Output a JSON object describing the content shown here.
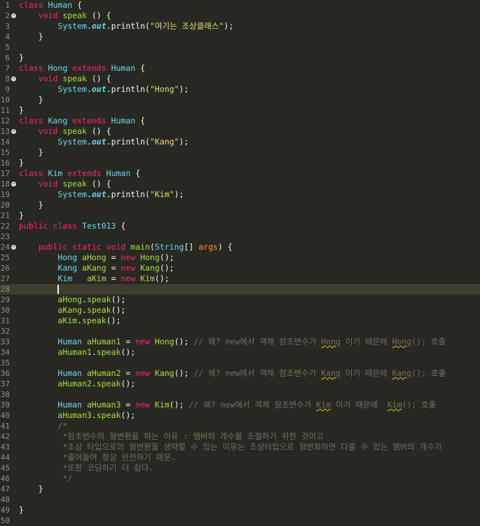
{
  "editor": {
    "current_line": 28,
    "lines": [
      {
        "n": 1,
        "fold": false,
        "segs": [
          [
            "k",
            "class "
          ],
          [
            "t",
            "Human"
          ],
          [
            "o",
            " {"
          ]
        ]
      },
      {
        "n": 2,
        "fold": true,
        "segs": [
          [
            "o",
            "    "
          ],
          [
            "k",
            "void "
          ],
          [
            "f",
            "speak"
          ],
          [
            "o",
            " () {"
          ]
        ]
      },
      {
        "n": 3,
        "fold": false,
        "segs": [
          [
            "o",
            "        "
          ],
          [
            "t",
            "System"
          ],
          [
            "o",
            "."
          ],
          [
            "fi",
            "out"
          ],
          [
            "o",
            "."
          ],
          [
            "o",
            "println("
          ],
          [
            "s",
            "\"여기는 조상클래스\""
          ],
          [
            "o",
            ");"
          ]
        ]
      },
      {
        "n": 4,
        "fold": false,
        "segs": [
          [
            "o",
            "    }"
          ]
        ]
      },
      {
        "n": 5,
        "fold": false,
        "segs": []
      },
      {
        "n": 6,
        "fold": false,
        "segs": [
          [
            "o",
            "}"
          ]
        ]
      },
      {
        "n": 7,
        "fold": false,
        "segs": [
          [
            "k",
            "class "
          ],
          [
            "t",
            "Hong "
          ],
          [
            "k",
            "extends "
          ],
          [
            "t",
            "Human"
          ],
          [
            "o",
            " {"
          ]
        ]
      },
      {
        "n": 8,
        "fold": true,
        "segs": [
          [
            "o",
            "    "
          ],
          [
            "k",
            "void "
          ],
          [
            "f",
            "speak"
          ],
          [
            "o",
            " () {"
          ]
        ]
      },
      {
        "n": 9,
        "fold": false,
        "segs": [
          [
            "o",
            "        "
          ],
          [
            "t",
            "System"
          ],
          [
            "o",
            "."
          ],
          [
            "fi",
            "out"
          ],
          [
            "o",
            "."
          ],
          [
            "o",
            "println("
          ],
          [
            "s",
            "\"Hong\""
          ],
          [
            "o",
            ");"
          ]
        ]
      },
      {
        "n": 10,
        "fold": false,
        "segs": [
          [
            "o",
            "    }"
          ]
        ]
      },
      {
        "n": 11,
        "fold": false,
        "segs": [
          [
            "o",
            "}"
          ]
        ]
      },
      {
        "n": 12,
        "fold": false,
        "segs": [
          [
            "k",
            "class "
          ],
          [
            "t",
            "Kang "
          ],
          [
            "k",
            "extends "
          ],
          [
            "t",
            "Human"
          ],
          [
            "o",
            " {"
          ]
        ]
      },
      {
        "n": 13,
        "fold": true,
        "segs": [
          [
            "o",
            "    "
          ],
          [
            "k",
            "void "
          ],
          [
            "f",
            "speak"
          ],
          [
            "o",
            " () {"
          ]
        ]
      },
      {
        "n": 14,
        "fold": false,
        "segs": [
          [
            "o",
            "        "
          ],
          [
            "t",
            "System"
          ],
          [
            "o",
            "."
          ],
          [
            "fi",
            "out"
          ],
          [
            "o",
            "."
          ],
          [
            "o",
            "println("
          ],
          [
            "s",
            "\"Kang\""
          ],
          [
            "o",
            ");"
          ]
        ]
      },
      {
        "n": 15,
        "fold": false,
        "segs": [
          [
            "o",
            "    }"
          ]
        ]
      },
      {
        "n": 16,
        "fold": false,
        "segs": [
          [
            "o",
            "}"
          ]
        ]
      },
      {
        "n": 17,
        "fold": false,
        "segs": [
          [
            "k",
            "class "
          ],
          [
            "t",
            "Kim "
          ],
          [
            "k",
            "extends "
          ],
          [
            "t",
            "Human"
          ],
          [
            "o",
            " {"
          ]
        ]
      },
      {
        "n": 18,
        "fold": true,
        "segs": [
          [
            "o",
            "    "
          ],
          [
            "k",
            "void "
          ],
          [
            "f",
            "speak"
          ],
          [
            "o",
            " () {"
          ]
        ]
      },
      {
        "n": 19,
        "fold": false,
        "segs": [
          [
            "o",
            "        "
          ],
          [
            "t",
            "System"
          ],
          [
            "o",
            "."
          ],
          [
            "fi",
            "out"
          ],
          [
            "o",
            "."
          ],
          [
            "o",
            "println("
          ],
          [
            "s",
            "\"Kim\""
          ],
          [
            "o",
            ");"
          ]
        ]
      },
      {
        "n": 20,
        "fold": false,
        "segs": [
          [
            "o",
            "    }"
          ]
        ]
      },
      {
        "n": 21,
        "fold": false,
        "segs": [
          [
            "o",
            "}"
          ]
        ]
      },
      {
        "n": 22,
        "fold": false,
        "segs": [
          [
            "k",
            "public class "
          ],
          [
            "t",
            "Test013"
          ],
          [
            "o",
            " {"
          ]
        ]
      },
      {
        "n": 23,
        "fold": false,
        "segs": []
      },
      {
        "n": 24,
        "fold": true,
        "segs": [
          [
            "o",
            "    "
          ],
          [
            "k",
            "public static void "
          ],
          [
            "f",
            "main"
          ],
          [
            "o",
            "("
          ],
          [
            "t",
            "String"
          ],
          [
            "o",
            "[] "
          ],
          [
            "p",
            "args"
          ],
          [
            "o",
            ") {"
          ]
        ]
      },
      {
        "n": 25,
        "fold": false,
        "segs": [
          [
            "o",
            "        "
          ],
          [
            "t",
            "Hong "
          ],
          [
            "f",
            "aHong"
          ],
          [
            "o",
            " = "
          ],
          [
            "k",
            "new "
          ],
          [
            "f",
            "Hong"
          ],
          [
            "o",
            "();"
          ]
        ]
      },
      {
        "n": 26,
        "fold": false,
        "segs": [
          [
            "o",
            "        "
          ],
          [
            "t",
            "Kang "
          ],
          [
            "f",
            "aKang"
          ],
          [
            "o",
            " = "
          ],
          [
            "k",
            "new "
          ],
          [
            "f",
            "Kang"
          ],
          [
            "o",
            "();"
          ]
        ]
      },
      {
        "n": 27,
        "fold": false,
        "segs": [
          [
            "o",
            "        "
          ],
          [
            "t",
            "Kim   "
          ],
          [
            "f",
            "aKim"
          ],
          [
            "o",
            " = "
          ],
          [
            "k",
            "new "
          ],
          [
            "f",
            "Kim"
          ],
          [
            "o",
            "();"
          ]
        ]
      },
      {
        "n": 28,
        "fold": false,
        "segs": [
          [
            "o",
            "        "
          ],
          [
            "caret",
            ""
          ]
        ]
      },
      {
        "n": 29,
        "fold": false,
        "segs": [
          [
            "o",
            "        "
          ],
          [
            "f",
            "aHong"
          ],
          [
            "o",
            "."
          ],
          [
            "f",
            "speak"
          ],
          [
            "o",
            "();"
          ]
        ]
      },
      {
        "n": 30,
        "fold": false,
        "segs": [
          [
            "o",
            "        "
          ],
          [
            "f",
            "aKang"
          ],
          [
            "o",
            "."
          ],
          [
            "f",
            "speak"
          ],
          [
            "o",
            "();"
          ]
        ]
      },
      {
        "n": 31,
        "fold": false,
        "segs": [
          [
            "o",
            "        "
          ],
          [
            "f",
            "aKim"
          ],
          [
            "o",
            "."
          ],
          [
            "f",
            "speak"
          ],
          [
            "o",
            "();"
          ]
        ]
      },
      {
        "n": 32,
        "fold": false,
        "segs": []
      },
      {
        "n": 33,
        "fold": false,
        "segs": [
          [
            "o",
            "        "
          ],
          [
            "t",
            "Human "
          ],
          [
            "f",
            "aHuman1"
          ],
          [
            "o",
            " = "
          ],
          [
            "k",
            "new "
          ],
          [
            "f",
            "Hong"
          ],
          [
            "o",
            "(); "
          ],
          [
            "c",
            "// 왜? new에서 객체 참조변수가 "
          ],
          [
            "cw",
            "Hong"
          ],
          [
            "c",
            " 이기 때문에 "
          ],
          [
            "cw",
            "Hong"
          ],
          [
            "c",
            "(); 호출"
          ]
        ]
      },
      {
        "n": 34,
        "fold": false,
        "segs": [
          [
            "o",
            "        "
          ],
          [
            "f",
            "aHuman1"
          ],
          [
            "o",
            "."
          ],
          [
            "f",
            "speak"
          ],
          [
            "o",
            "();"
          ]
        ]
      },
      {
        "n": 35,
        "fold": false,
        "segs": []
      },
      {
        "n": 36,
        "fold": false,
        "segs": [
          [
            "o",
            "        "
          ],
          [
            "t",
            "Human "
          ],
          [
            "f",
            "aHuman2"
          ],
          [
            "o",
            " = "
          ],
          [
            "k",
            "new "
          ],
          [
            "f",
            "Kang"
          ],
          [
            "o",
            "(); "
          ],
          [
            "c",
            "// 왜? new에서 객체 참조변수가 "
          ],
          [
            "cw",
            "Kang"
          ],
          [
            "c",
            " 이기 때문에 "
          ],
          [
            "cw",
            "Kang"
          ],
          [
            "c",
            "(); 호출"
          ]
        ]
      },
      {
        "n": 37,
        "fold": false,
        "segs": [
          [
            "o",
            "        "
          ],
          [
            "f",
            "aHuman2"
          ],
          [
            "o",
            "."
          ],
          [
            "f",
            "speak"
          ],
          [
            "o",
            "();"
          ]
        ]
      },
      {
        "n": 38,
        "fold": false,
        "segs": []
      },
      {
        "n": 39,
        "fold": false,
        "segs": [
          [
            "o",
            "        "
          ],
          [
            "t",
            "Human "
          ],
          [
            "f",
            "aHuman3"
          ],
          [
            "o",
            " = "
          ],
          [
            "k",
            "new "
          ],
          [
            "f",
            "Kim"
          ],
          [
            "o",
            "(); "
          ],
          [
            "c",
            "// 왜? new에서 객체 참조변수가 "
          ],
          [
            "cw",
            "Kim"
          ],
          [
            "c",
            " 이기 때문에  "
          ],
          [
            "cw",
            "Kim"
          ],
          [
            "c",
            "(); 호출"
          ]
        ]
      },
      {
        "n": 40,
        "fold": false,
        "segs": [
          [
            "o",
            "        "
          ],
          [
            "f",
            "aHuman3"
          ],
          [
            "o",
            "."
          ],
          [
            "f",
            "speak"
          ],
          [
            "o",
            "();"
          ]
        ]
      },
      {
        "n": 41,
        "fold": false,
        "segs": [
          [
            "o",
            "        "
          ],
          [
            "c",
            "/*"
          ]
        ]
      },
      {
        "n": 42,
        "fold": false,
        "segs": [
          [
            "o",
            "         "
          ],
          [
            "c",
            "*참조변수의 형변환을 하는 이유 : 멤버의 개수를 조절하기 위한 것이고"
          ]
        ]
      },
      {
        "n": 43,
        "fold": false,
        "segs": [
          [
            "o",
            "         "
          ],
          [
            "c",
            "*조상 타입으로의 형변환을 생략할 수 있는 이유는 조상타입으로 형변화하면 다룰 수 있는 멤버의 개수가"
          ]
        ]
      },
      {
        "n": 44,
        "fold": false,
        "segs": [
          [
            "o",
            "         "
          ],
          [
            "c",
            "*줄어들어 항상 안전하기 때문."
          ]
        ]
      },
      {
        "n": 45,
        "fold": false,
        "segs": [
          [
            "o",
            "         "
          ],
          [
            "c",
            "*또한 코딩하기 더 쉽다."
          ]
        ]
      },
      {
        "n": 46,
        "fold": false,
        "segs": [
          [
            "o",
            "         "
          ],
          [
            "c",
            "*/"
          ]
        ]
      },
      {
        "n": 47,
        "fold": false,
        "segs": [
          [
            "o",
            "    }"
          ]
        ]
      },
      {
        "n": 48,
        "fold": false,
        "segs": []
      },
      {
        "n": 49,
        "fold": false,
        "segs": [
          [
            "o",
            "}"
          ]
        ]
      },
      {
        "n": 50,
        "fold": false,
        "segs": []
      }
    ]
  }
}
